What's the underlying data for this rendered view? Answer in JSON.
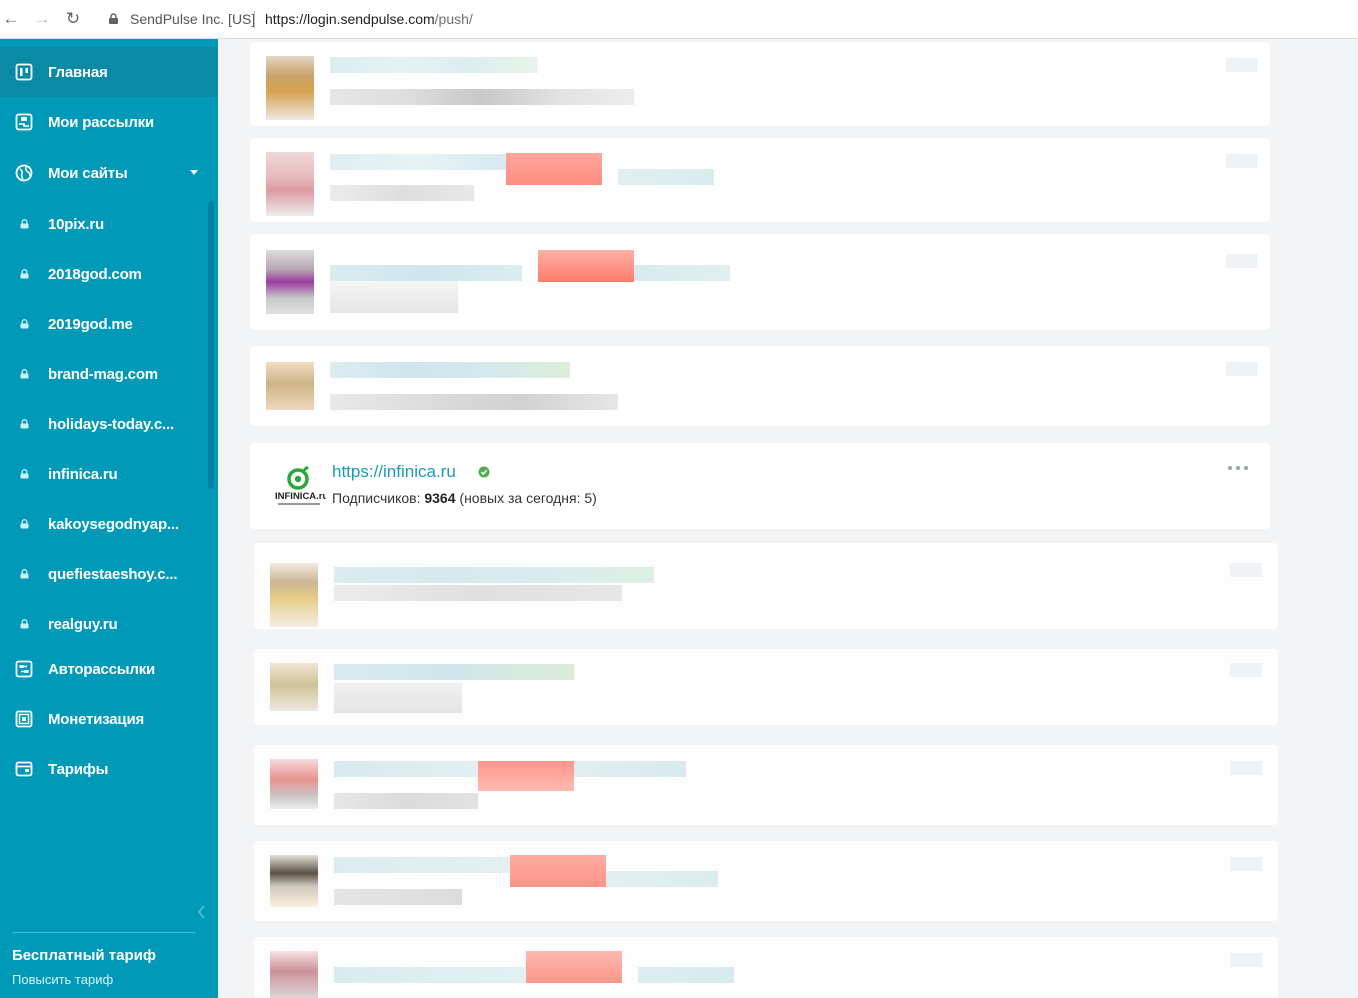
{
  "browser": {
    "cert_label": "SendPulse Inc. [US]",
    "url_host": "https://login.sendpulse.com",
    "url_path": "/push/"
  },
  "sidebar": {
    "items": [
      {
        "label": "Главная",
        "icon": "dashboard-icon"
      },
      {
        "label": "Мои рассылки",
        "icon": "mailings-icon"
      },
      {
        "label": "Мои сайты",
        "icon": "globe-icon"
      },
      {
        "label": "10pix.ru",
        "icon": "lock-icon"
      },
      {
        "label": "2018god.com",
        "icon": "lock-icon"
      },
      {
        "label": "2019god.me",
        "icon": "lock-icon"
      },
      {
        "label": "brand-mag.com",
        "icon": "lock-icon"
      },
      {
        "label": "holidays-today.c...",
        "icon": "lock-icon"
      },
      {
        "label": "infinica.ru",
        "icon": "lock-icon"
      },
      {
        "label": "kakoysegodnyap...",
        "icon": "lock-icon"
      },
      {
        "label": "quefiestaeshoy.c...",
        "icon": "lock-icon"
      },
      {
        "label": "realguy.ru",
        "icon": "lock-icon"
      },
      {
        "label": "Авторассылки",
        "icon": "automation-icon"
      },
      {
        "label": "Монетизация",
        "icon": "monetization-icon"
      },
      {
        "label": "Тарифы",
        "icon": "wallet-icon"
      }
    ],
    "plan_title": "Бесплатный тариф",
    "plan_upgrade": "Повысить тариф"
  },
  "site_card": {
    "url": "https://infinica.ru",
    "logo_text": "INFINICA.ru",
    "subs_label": "Подписчиков:",
    "subs_count": "9364",
    "subs_today": "(новых за сегодня: 5)"
  },
  "colors": {
    "sidebar_bg": "#0099b8",
    "sidebar_active": "#0b8aa6",
    "link": "#1a9ab6",
    "verified": "#4caf50"
  }
}
